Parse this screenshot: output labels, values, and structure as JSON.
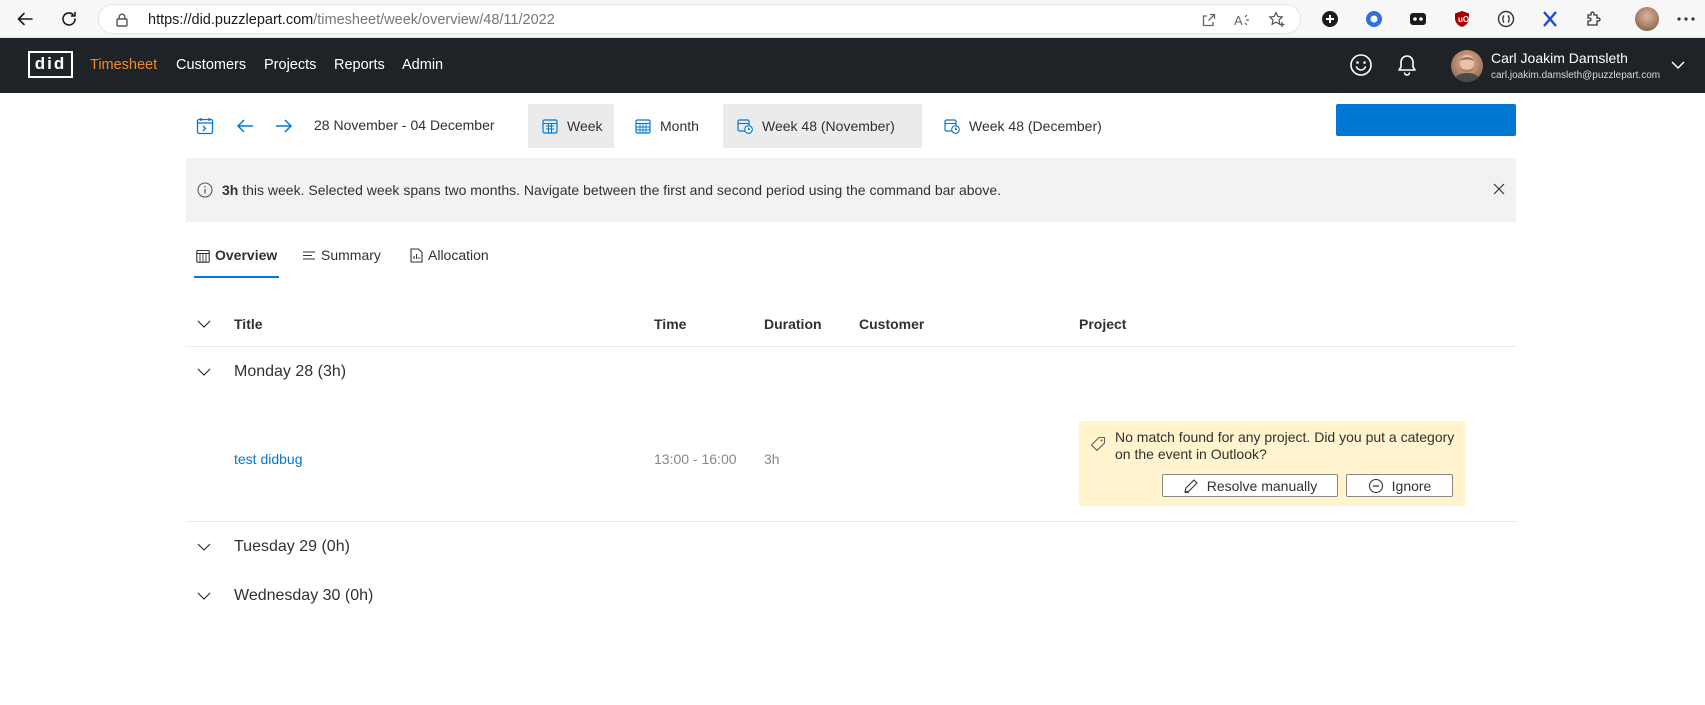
{
  "browser": {
    "url_domain": "https://did.puzzlepart.com",
    "url_path": "/timesheet/week/overview/48/11/2022"
  },
  "app": {
    "logo": "did",
    "nav": [
      "Timesheet",
      "Customers",
      "Projects",
      "Reports",
      "Admin"
    ],
    "active_nav": "Timesheet",
    "user": {
      "name": "Carl Joakim Damsleth",
      "email": "carl.joakim.damsleth@puzzlepart.com"
    }
  },
  "commandbar": {
    "date_range": "28 November - 04 December",
    "week_label": "Week",
    "month_label": "Month",
    "period_1_label": "Week 48 (November)",
    "period_2_label": "Week 48 (December)"
  },
  "message": {
    "hours": "3h",
    "text": " this week. Selected week spans two months. Navigate between the first and second period using the command bar above."
  },
  "tabs": {
    "overview": "Overview",
    "summary": "Summary",
    "allocation": "Allocation"
  },
  "columns": {
    "title": "Title",
    "time": "Time",
    "duration": "Duration",
    "customer": "Customer",
    "project": "Project"
  },
  "groups": [
    {
      "label": "Monday 28 (3h)",
      "events": [
        {
          "title": "test didbug",
          "time": "13:00 - 16:00",
          "duration": "3h",
          "warning": "No match found for any project. Did you put a category on the event in Outlook?",
          "resolve_label": "Resolve manually",
          "ignore_label": "Ignore"
        }
      ]
    },
    {
      "label": "Tuesday 29 (0h)"
    },
    {
      "label": "Wednesday 30 (0h)"
    }
  ],
  "colors": {
    "accent": "#0078d4",
    "active_nav": "#f08a24",
    "header_bg": "#1f2328",
    "warning_bg": "#fff4ce",
    "message_bg": "#f3f2f1"
  },
  "icons": [
    "back-arrow-icon",
    "reload-icon",
    "lock-icon",
    "open-external-icon",
    "read-aloud-icon",
    "favorites-icon",
    "calendar-today-icon",
    "arrow-left-icon",
    "arrow-right-icon",
    "calendar-week-icon",
    "calendar-month-icon",
    "calendar-clock-icon",
    "info-icon",
    "close-icon",
    "chevron-down-icon",
    "tag-icon",
    "edit-pen-icon",
    "block-icon",
    "smiley-icon",
    "bell-icon"
  ]
}
